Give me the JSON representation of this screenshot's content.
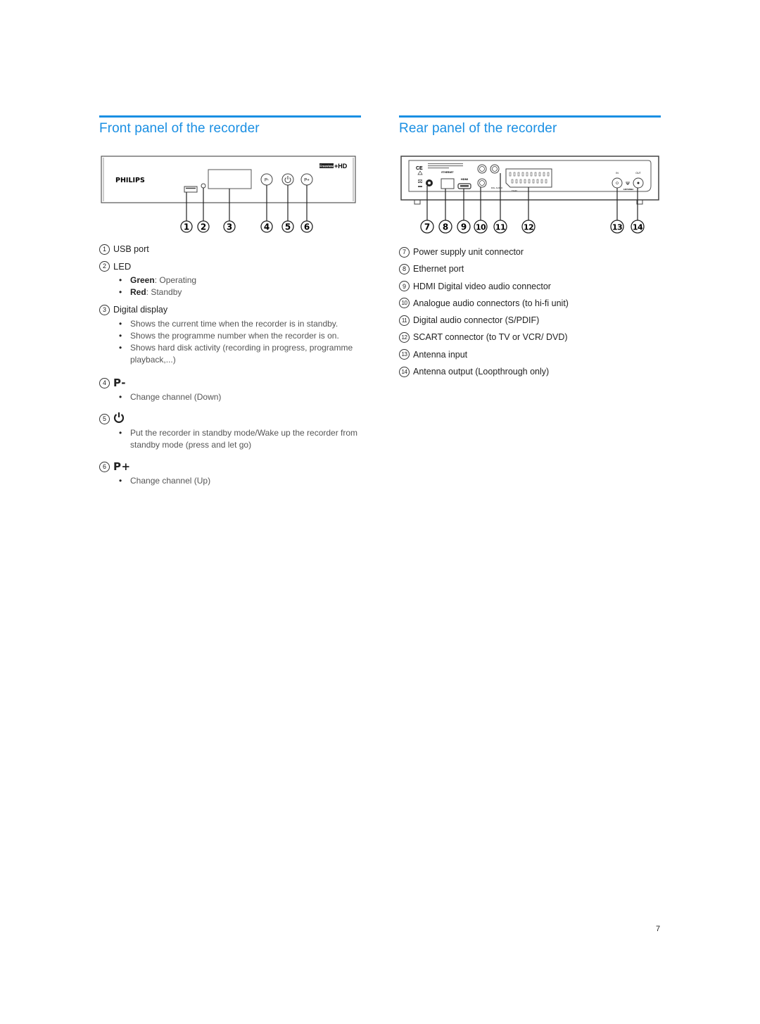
{
  "front_panel": {
    "title": "Front panel of the recorder",
    "device": {
      "brand": "PHILIPS",
      "logo_badge": "Freeview",
      "logo_suffix": "+HD",
      "buttons": [
        "P-",
        "⏻",
        "P+"
      ],
      "callouts": [
        "1",
        "2",
        "3",
        "4",
        "5",
        "6"
      ]
    },
    "items": [
      {
        "num": "1",
        "label": "USB port"
      },
      {
        "num": "2",
        "label": "LED",
        "bullets": [
          {
            "bold": "Green",
            "text": ": Operating"
          },
          {
            "bold": "Red",
            "text": ": Standby"
          }
        ]
      },
      {
        "num": "3",
        "label": "Digital display",
        "bullets": [
          {
            "text": "Shows the current time when the recorder is in standby."
          },
          {
            "text": "Shows the programme number when the recorder is on."
          },
          {
            "text": "Shows hard disk activity (recording in progress, programme playback,...)"
          }
        ]
      },
      {
        "num": "4",
        "label": "P-",
        "bullets": [
          {
            "text": "Change channel (Down)"
          }
        ]
      },
      {
        "num": "5",
        "label": "⏻",
        "bullets": [
          {
            "text": "Put the recorder in standby mode/Wake up the recorder from standby mode (press and let go)"
          }
        ]
      },
      {
        "num": "6",
        "label": "P+",
        "bullets": [
          {
            "text": "Change channel (Up)"
          }
        ]
      }
    ]
  },
  "rear_panel": {
    "title": "Rear panel of the recorder",
    "device": {
      "labels": [
        "ETHERNET",
        "HDMI",
        "DIG. AUDIO",
        "TV-IN",
        "IN",
        "OUT",
        "ANTENNA"
      ],
      "callouts": [
        "7",
        "8",
        "9",
        "10",
        "11",
        "12",
        "13",
        "14"
      ]
    },
    "items": [
      {
        "num": "7",
        "label": "Power supply unit connector"
      },
      {
        "num": "8",
        "label": "Ethernet port"
      },
      {
        "num": "9",
        "label": "HDMI Digital video audio connector"
      },
      {
        "num": "10",
        "label": "Analogue audio connectors (to hi-fi unit)"
      },
      {
        "num": "11",
        "label": "Digital audio connector (S/PDIF)"
      },
      {
        "num": "12",
        "label": "SCART connector (to TV or VCR/ DVD)"
      },
      {
        "num": "13",
        "label": "Antenna input"
      },
      {
        "num": "14",
        "label": "Antenna output (Loopthrough only)"
      }
    ]
  },
  "page_number": "7",
  "colors": {
    "accent": "#1a8fe3",
    "text": "#222222",
    "muted": "#555555"
  }
}
